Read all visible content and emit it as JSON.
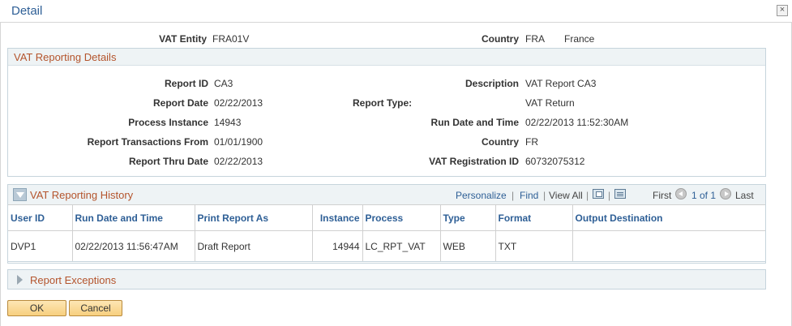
{
  "window": {
    "title": "Detail",
    "close_glyph": "×"
  },
  "header": {
    "vat_entity_label": "VAT Entity",
    "vat_entity_value": "FRA01V",
    "country_label": "Country",
    "country_code": "FRA",
    "country_name": "France"
  },
  "details": {
    "title": "VAT Reporting Details",
    "report_id_label": "Report ID",
    "report_id": "CA3",
    "description_label": "Description",
    "description": "VAT Report CA3",
    "report_date_label": "Report Date",
    "report_date": "02/22/2013",
    "report_type_label": "Report Type:",
    "report_type": "VAT Return",
    "process_instance_label": "Process Instance",
    "process_instance": "14943",
    "run_date_label": "Run Date and Time",
    "run_date": "02/22/2013 11:52:30AM",
    "transactions_from_label": "Report Transactions From",
    "transactions_from": "01/01/1900",
    "country_label": "Country",
    "country": "FR",
    "thru_date_label": "Report Thru Date",
    "thru_date": "02/22/2013",
    "vat_reg_label": "VAT Registration ID",
    "vat_reg": "60732075312"
  },
  "history": {
    "title": "VAT Reporting History",
    "personalize": "Personalize",
    "find": "Find",
    "sep": "|",
    "view_all": "View All",
    "first": "First",
    "range": "1 of 1",
    "last": "Last",
    "columns": [
      "User ID",
      "Run Date and Time",
      "Print Report As",
      "Instance",
      "Process",
      "Type",
      "Format",
      "Output Destination"
    ],
    "rows": [
      [
        "DVP1",
        "02/22/2013 11:56:47AM",
        "Draft Report",
        "14944",
        "LC_RPT_VAT",
        "WEB",
        "TXT",
        ""
      ]
    ]
  },
  "exceptions": {
    "title": "Report Exceptions"
  },
  "buttons": {
    "ok": "OK",
    "cancel": "Cancel"
  },
  "colors": {
    "link": "#2e5f96",
    "section_title": "#b4542c",
    "header_bg": "#eef3f5"
  }
}
